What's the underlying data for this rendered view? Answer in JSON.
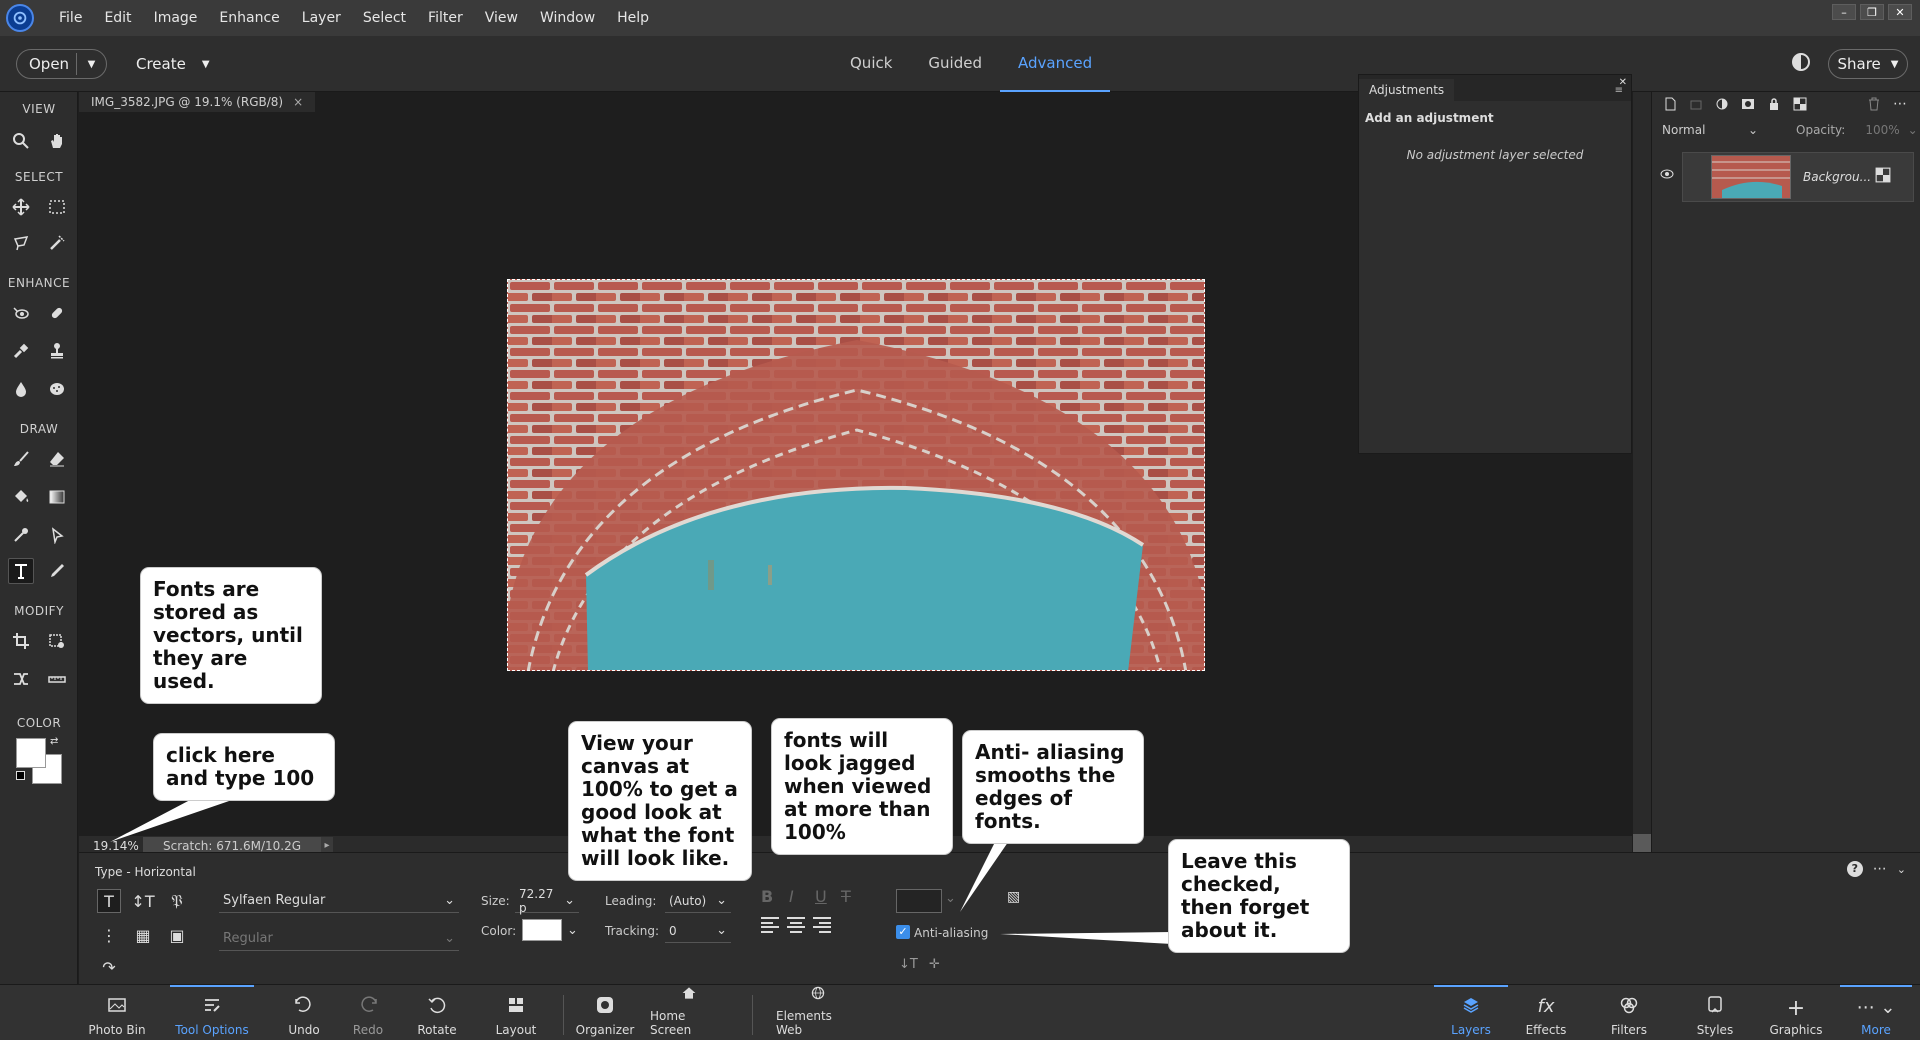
{
  "menubar": {
    "items": [
      "File",
      "Edit",
      "Image",
      "Enhance",
      "Layer",
      "Select",
      "Filter",
      "View",
      "Window",
      "Help"
    ]
  },
  "modebar": {
    "open_label": "Open",
    "create_label": "Create",
    "tabs": [
      "Quick",
      "Guided",
      "Advanced"
    ],
    "active_tab": "Advanced",
    "share_label": "Share"
  },
  "toolbar": {
    "sections": [
      "VIEW",
      "SELECT",
      "ENHANCE",
      "DRAW",
      "MODIFY",
      "COLOR"
    ]
  },
  "document": {
    "tab_label": "IMG_3582.JPG @ 19.1% (RGB/8)",
    "zoom": "19.14%",
    "scratch": "Scratch: 671.6M/10.2G"
  },
  "adjustments": {
    "tab": "Adjustments",
    "title": "Add an adjustment",
    "empty": "No adjustment layer selected"
  },
  "layers": {
    "blend_mode": "Normal",
    "opacity_label": "Opacity:",
    "opacity_value": "100%",
    "layer_name": "Backgrou..."
  },
  "tool_options": {
    "title": "Type - Horizontal",
    "font_family": "Sylfaen Regular",
    "font_style": "Regular",
    "size_label": "Size:",
    "size_value": "72.27 p",
    "leading_label": "Leading:",
    "leading_value": "(Auto)",
    "color_label": "Color:",
    "tracking_label": "Tracking:",
    "tracking_value": "0",
    "anti_aliasing_label": "Anti-aliasing",
    "anti_aliasing_checked": true
  },
  "bottombar": {
    "items": [
      "Photo Bin",
      "Tool Options",
      "Undo",
      "Redo",
      "Rotate",
      "Layout",
      "Organizer",
      "Home Screen",
      "Elements Web",
      "Layers",
      "Effects",
      "Filters",
      "Styles",
      "Graphics",
      "More"
    ]
  },
  "callouts": {
    "c1": "Fonts are stored as vectors, until they are used.",
    "c2": "click here and type 100",
    "c3": "View your canvas at 100% to get a good look at what the font will look like.",
    "c4": "fonts will look jagged when viewed at more than 100%",
    "c5": "Anti- aliasing smooths the edges of fonts.",
    "c6": "Leave this checked, then forget about it."
  },
  "colors": {
    "accent": "#5aa3ff",
    "brick": "#b5574c",
    "door": "#4aa9b6"
  }
}
